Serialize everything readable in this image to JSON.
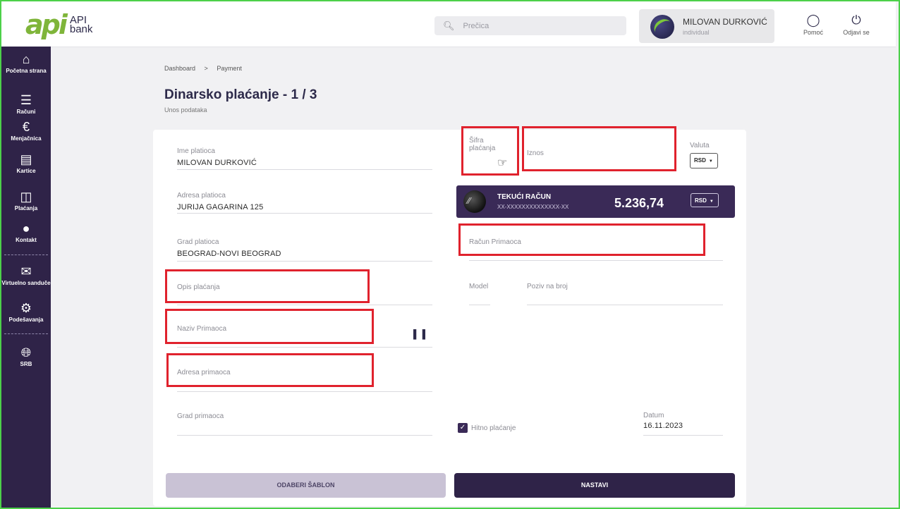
{
  "header": {
    "logo_mark": "api",
    "logo_text_1": "API",
    "logo_text_2": "bank",
    "search_placeholder": "Prečica",
    "user_name": "MILOVAN DURKOVIĆ",
    "user_type": "individual",
    "help_label": "Pomoć",
    "logout_label": "Odjavi se"
  },
  "sidebar": {
    "items": [
      {
        "label": "Početna strana",
        "icon": "home-icon"
      },
      {
        "label": "Računi",
        "icon": "list-icon"
      },
      {
        "label": "Menjačnica",
        "icon": "exchange-icon"
      },
      {
        "label": "Kartice",
        "icon": "card-icon"
      },
      {
        "label": "Plaćanja",
        "icon": "wallet-icon"
      },
      {
        "label": "Kontakt",
        "icon": "contact-icon"
      },
      {
        "label": "Virtuelno sanduče",
        "icon": "mail-icon"
      },
      {
        "label": "Podešavanja",
        "icon": "gear-icon"
      },
      {
        "label": "SRB",
        "icon": "globe-icon"
      }
    ]
  },
  "breadcrumb": {
    "items": [
      "Dashboard",
      ">",
      "Payment"
    ]
  },
  "page": {
    "title": "Dinarsko plaćanje - 1 / 3",
    "subtitle": "Unos podataka"
  },
  "form": {
    "payer_name_label": "Ime platioca",
    "payer_name_value": "MILOVAN DURKOVIĆ",
    "payer_address_label": "Adresa platioca",
    "payer_address_value": "JURIJA GAGARINA 125",
    "payer_city_label": "Grad platioca",
    "payer_city_value": "BEOGRAD-NOVI BEOGRAD",
    "payment_desc_placeholder": "Opis plaćanja",
    "recipient_name_placeholder": "Naziv Primaoca",
    "recipient_address_placeholder": "Adresa primaoca",
    "recipient_city_label": "Grad primaoca",
    "payment_code_label_1": "Šifra",
    "payment_code_label_2": "plaćanja",
    "amount_placeholder": "Iznos",
    "currency_label": "Valuta",
    "currency_value": "RSD",
    "recipient_account_placeholder": "Račun Primaoca",
    "model_label": "Model",
    "reference_label": "Poziv na broj",
    "urgent_label": "Hitno plaćanje",
    "date_label": "Datum",
    "date_value": "16.11.2023"
  },
  "account": {
    "title": "TEKUĆI RAČUN",
    "number": "XX-XXXXXXXXXXXXXX-XX",
    "balance": "5.236,74",
    "currency": "RSD"
  },
  "buttons": {
    "template_label": "ODABERI ŠABLON",
    "next_label": "NASTAVI"
  }
}
